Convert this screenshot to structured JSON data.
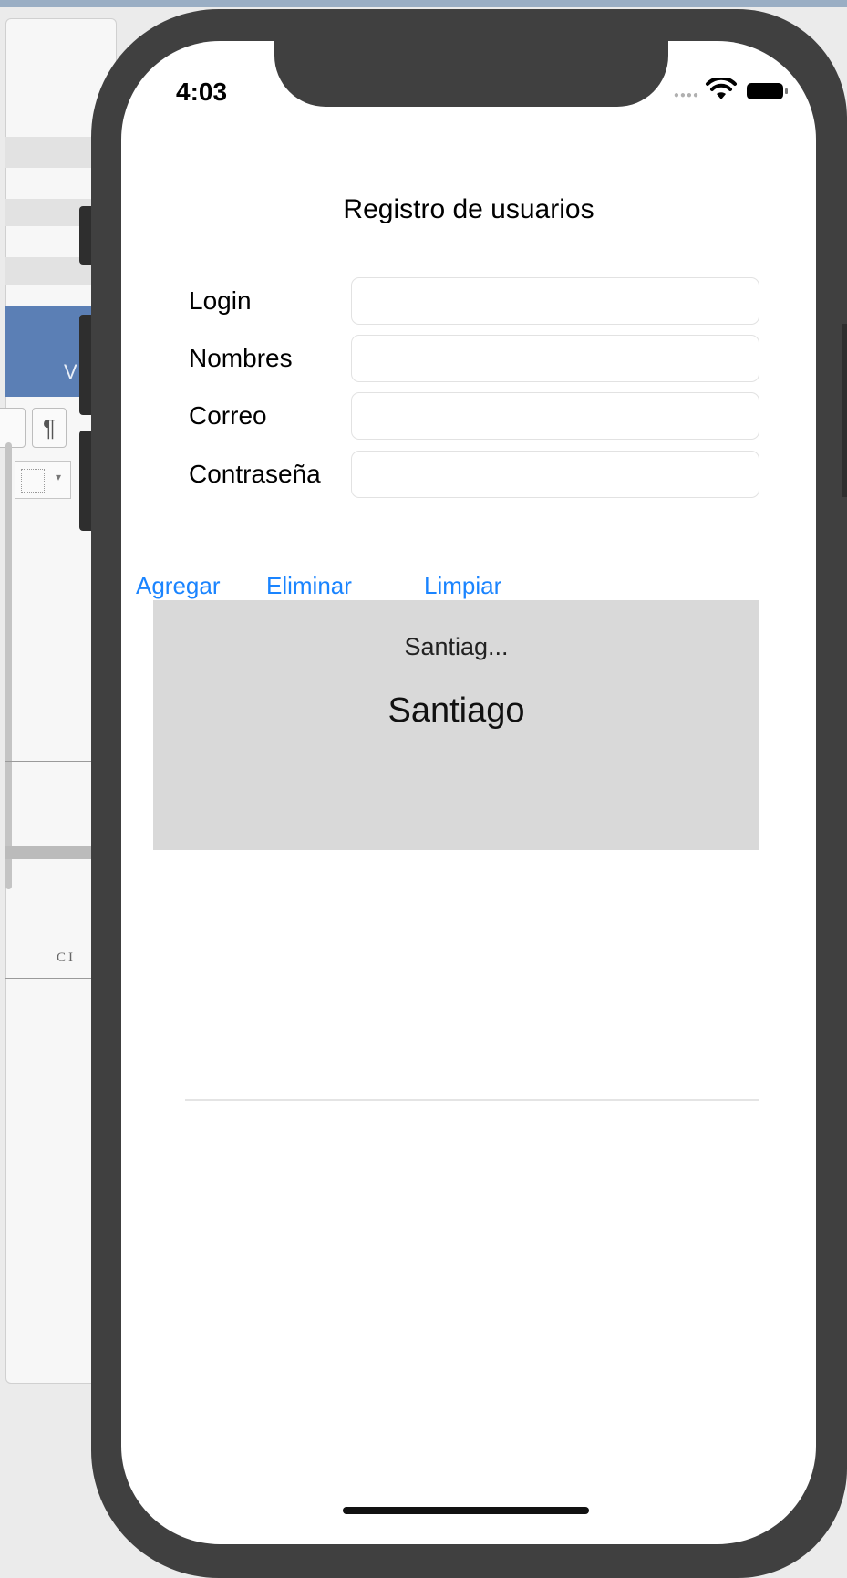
{
  "background": {
    "pilcrow_glyph": "¶",
    "ribbon_letter": "V",
    "doc_text": "CI"
  },
  "status_bar": {
    "time": "4:03",
    "wifi_icon": "wifi-icon",
    "battery_icon": "battery-icon"
  },
  "form": {
    "title": "Registro de usuarios",
    "fields": [
      {
        "label": "Login",
        "value": ""
      },
      {
        "label": "Nombres",
        "value": ""
      },
      {
        "label": "Correo",
        "value": ""
      },
      {
        "label": "Contraseña",
        "value": ""
      }
    ]
  },
  "actions": {
    "add_label": "Agregar",
    "delete_label": "Eliminar",
    "clear_label": "Limpiar"
  },
  "picker": {
    "header_text": "Santiag...",
    "selected_value": "Santiago"
  },
  "colors": {
    "accent": "#1a84ff",
    "device_frame": "#404040",
    "picker_background": "#d9d9d9"
  }
}
